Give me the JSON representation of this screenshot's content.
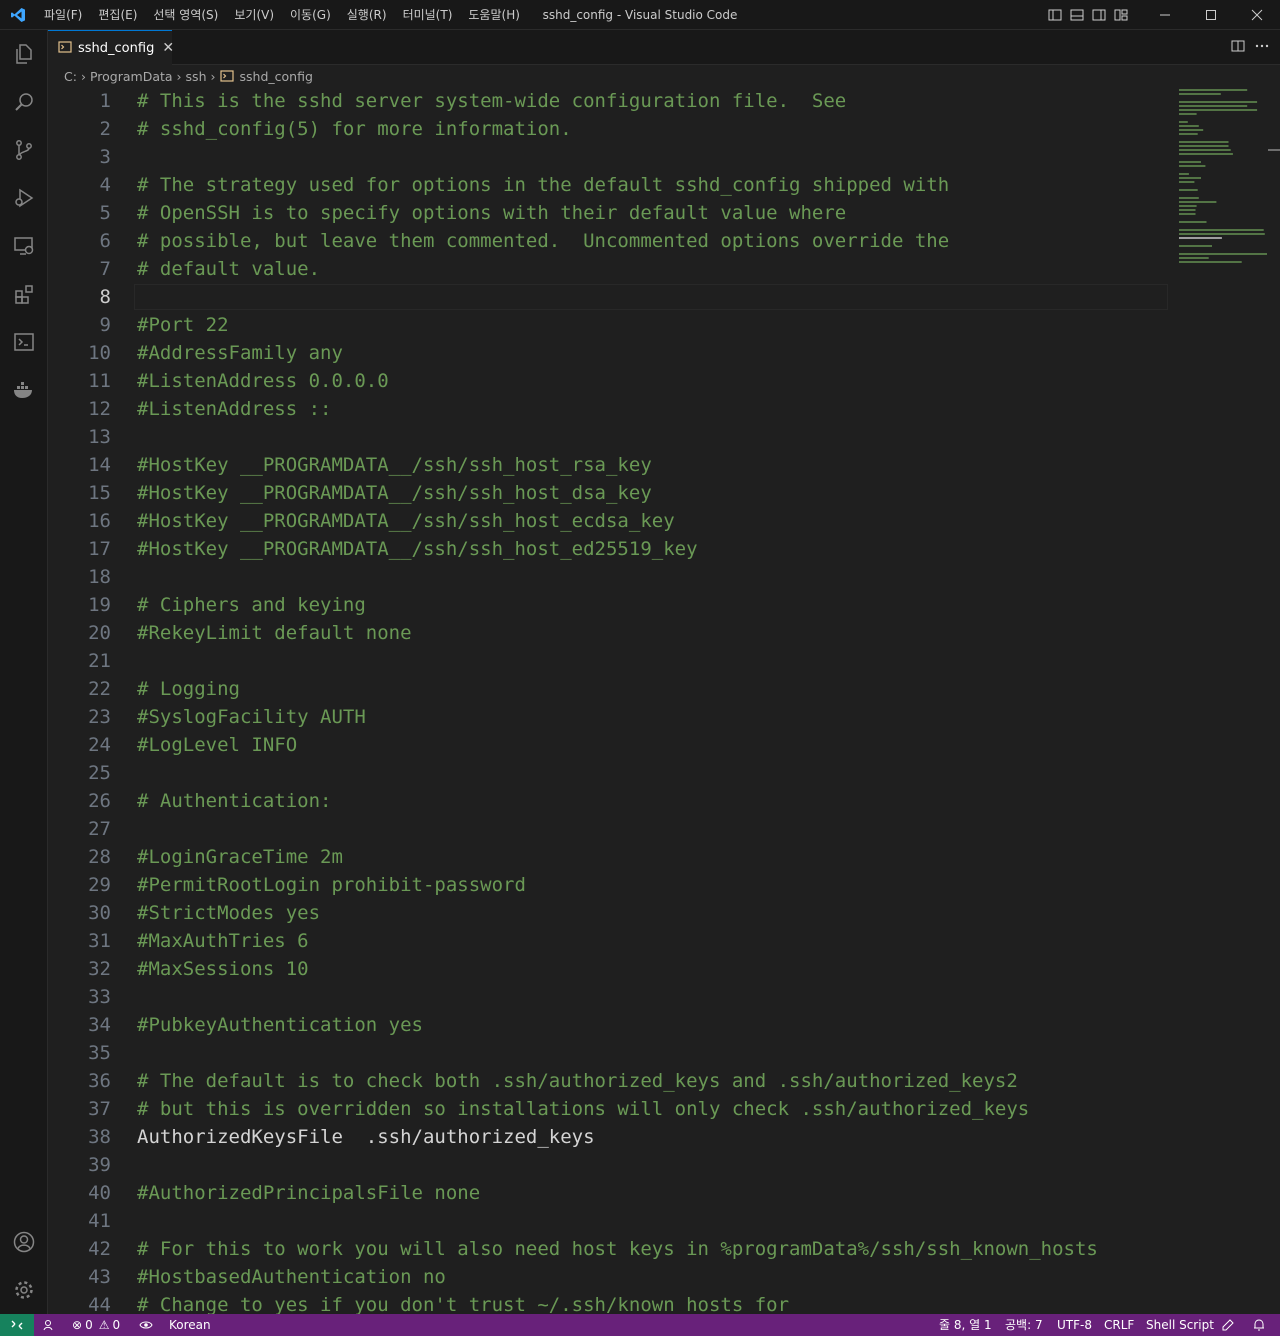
{
  "window": {
    "title": "sshd_config - Visual Studio Code",
    "menu": [
      "파일(F)",
      "편집(E)",
      "선택 영역(S)",
      "보기(V)",
      "이동(G)",
      "실행(R)",
      "터미널(T)",
      "도움말(H)"
    ]
  },
  "tab": {
    "label": "sshd_config"
  },
  "breadcrumb": [
    "C:",
    "ProgramData",
    "ssh",
    "sshd_config"
  ],
  "editor": {
    "current_line": 8,
    "lines": [
      {
        "n": "1",
        "t": "# This is the sshd server system-wide configuration file.  See",
        "c": true
      },
      {
        "n": "2",
        "t": "# sshd_config(5) for more information.",
        "c": true
      },
      {
        "n": "3",
        "t": "",
        "c": true
      },
      {
        "n": "4",
        "t": "# The strategy used for options in the default sshd_config shipped with",
        "c": true
      },
      {
        "n": "5",
        "t": "# OpenSSH is to specify options with their default value where",
        "c": true
      },
      {
        "n": "6",
        "t": "# possible, but leave them commented.  Uncommented options override the",
        "c": true
      },
      {
        "n": "7",
        "t": "# default value.",
        "c": true
      },
      {
        "n": "8",
        "t": "",
        "c": true
      },
      {
        "n": "9",
        "t": "#Port 22",
        "c": true
      },
      {
        "n": "10",
        "t": "#AddressFamily any",
        "c": true
      },
      {
        "n": "11",
        "t": "#ListenAddress 0.0.0.0",
        "c": true
      },
      {
        "n": "12",
        "t": "#ListenAddress ::",
        "c": true
      },
      {
        "n": "13",
        "t": "",
        "c": true
      },
      {
        "n": "14",
        "t": "#HostKey __PROGRAMDATA__/ssh/ssh_host_rsa_key",
        "c": true
      },
      {
        "n": "15",
        "t": "#HostKey __PROGRAMDATA__/ssh/ssh_host_dsa_key",
        "c": true
      },
      {
        "n": "16",
        "t": "#HostKey __PROGRAMDATA__/ssh/ssh_host_ecdsa_key",
        "c": true
      },
      {
        "n": "17",
        "t": "#HostKey __PROGRAMDATA__/ssh/ssh_host_ed25519_key",
        "c": true
      },
      {
        "n": "18",
        "t": "",
        "c": true
      },
      {
        "n": "19",
        "t": "# Ciphers and keying",
        "c": true
      },
      {
        "n": "20",
        "t": "#RekeyLimit default none",
        "c": true
      },
      {
        "n": "21",
        "t": "",
        "c": true
      },
      {
        "n": "22",
        "t": "# Logging",
        "c": true
      },
      {
        "n": "23",
        "t": "#SyslogFacility AUTH",
        "c": true
      },
      {
        "n": "24",
        "t": "#LogLevel INFO",
        "c": true
      },
      {
        "n": "25",
        "t": "",
        "c": true
      },
      {
        "n": "26",
        "t": "# Authentication:",
        "c": true
      },
      {
        "n": "27",
        "t": "",
        "c": true
      },
      {
        "n": "28",
        "t": "#LoginGraceTime 2m",
        "c": true
      },
      {
        "n": "29",
        "t": "#PermitRootLogin prohibit-password",
        "c": true
      },
      {
        "n": "30",
        "t": "#StrictModes yes",
        "c": true
      },
      {
        "n": "31",
        "t": "#MaxAuthTries 6",
        "c": true
      },
      {
        "n": "32",
        "t": "#MaxSessions 10",
        "c": true
      },
      {
        "n": "33",
        "t": "",
        "c": true
      },
      {
        "n": "34",
        "t": "#PubkeyAuthentication yes",
        "c": true
      },
      {
        "n": "35",
        "t": "",
        "c": true
      },
      {
        "n": "36",
        "t": "# The default is to check both .ssh/authorized_keys and .ssh/authorized_keys2",
        "c": true
      },
      {
        "n": "37",
        "t": "# but this is overridden so installations will only check .ssh/authorized_keys",
        "c": true
      },
      {
        "n": "38",
        "t": "AuthorizedKeysFile\t.ssh/authorized_keys",
        "c": false
      },
      {
        "n": "39",
        "t": "",
        "c": true
      },
      {
        "n": "40",
        "t": "#AuthorizedPrincipalsFile none",
        "c": true
      },
      {
        "n": "41",
        "t": "",
        "c": true
      },
      {
        "n": "42",
        "t": "# For this to work you will also need host keys in %programData%/ssh/ssh_known_hosts",
        "c": true
      },
      {
        "n": "43",
        "t": "#HostbasedAuthentication no",
        "c": true
      },
      {
        "n": "44",
        "t": "# Change to yes if you don't trust ~/.ssh/known_hosts for",
        "c": true
      }
    ]
  },
  "statusbar": {
    "errors": "0",
    "warnings": "0",
    "language_input": "Korean",
    "position": "줄 8, 열 1",
    "indent": "공백: 7",
    "encoding": "UTF-8",
    "eol": "CRLF",
    "language_mode": "Shell Script"
  },
  "colors": {
    "comment": "#6a9955",
    "text": "#d4d4d4",
    "statusbar": "#68217a",
    "remote": "#16825d",
    "accent": "#0078d4"
  }
}
